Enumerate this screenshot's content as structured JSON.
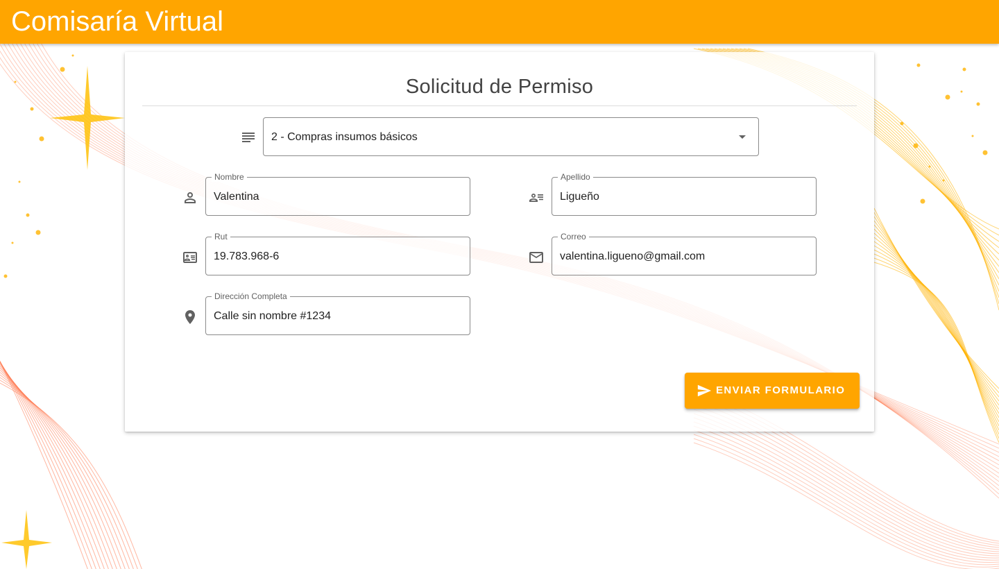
{
  "app": {
    "title": "Comisaría Virtual"
  },
  "form": {
    "title": "Solicitud de Permiso",
    "motive_select": {
      "value": "2 - Compras insumos básicos"
    },
    "fields": {
      "nombre": {
        "label": "Nombre",
        "value": "Valentina"
      },
      "apellido": {
        "label": "Apellido",
        "value": "Ligueño"
      },
      "rut": {
        "label": "Rut",
        "value": "19.783.968-6"
      },
      "correo": {
        "label": "Correo",
        "value": "valentina.ligueno@gmail.com"
      },
      "direccion": {
        "label": "Dirección Completa",
        "value": "Calle sin nombre #1234"
      }
    },
    "submit_label": "ENVIAR FORMULARIO"
  },
  "icons": {
    "motive": "notes-icon",
    "nombre": "person-icon",
    "apellido": "person-details-icon",
    "rut": "id-card-icon",
    "correo": "mail-icon",
    "direccion": "location-pin-icon",
    "submit": "send-icon"
  },
  "colors": {
    "accent": "#ffa500",
    "field_border": "#8a8a8a",
    "icon": "#616161",
    "bg_lines_orange": "#ff7043",
    "bg_lines_gold": "#ffb300"
  }
}
